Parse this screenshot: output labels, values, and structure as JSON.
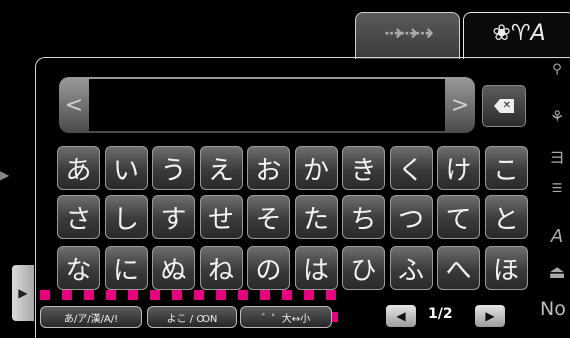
{
  "tabs": [
    {
      "label": "⇢⇢⇢"
    },
    {
      "label": "❀♈A"
    }
  ],
  "input": {
    "left_arrow": "<",
    "right_arrow": ">",
    "value": ""
  },
  "keys": [
    [
      "あ",
      "い",
      "う",
      "え",
      "お",
      "か",
      "き",
      "く",
      "け",
      "こ"
    ],
    [
      "さ",
      "し",
      "す",
      "せ",
      "そ",
      "た",
      "ち",
      "つ",
      "て",
      "と"
    ],
    [
      "な",
      "に",
      "ぬ",
      "ね",
      "の",
      "は",
      "ひ",
      "ふ",
      "へ",
      "ほ"
    ]
  ],
  "mode_buttons": {
    "script": "あ/ア/漢/A/!",
    "orientation": "よこ / ꝎN",
    "modifiers": "゛゜大↔小"
  },
  "page": {
    "indicator": "1/2"
  },
  "side": {
    "tail_text": "No"
  },
  "colors": {
    "highlight": "#e6007e"
  }
}
